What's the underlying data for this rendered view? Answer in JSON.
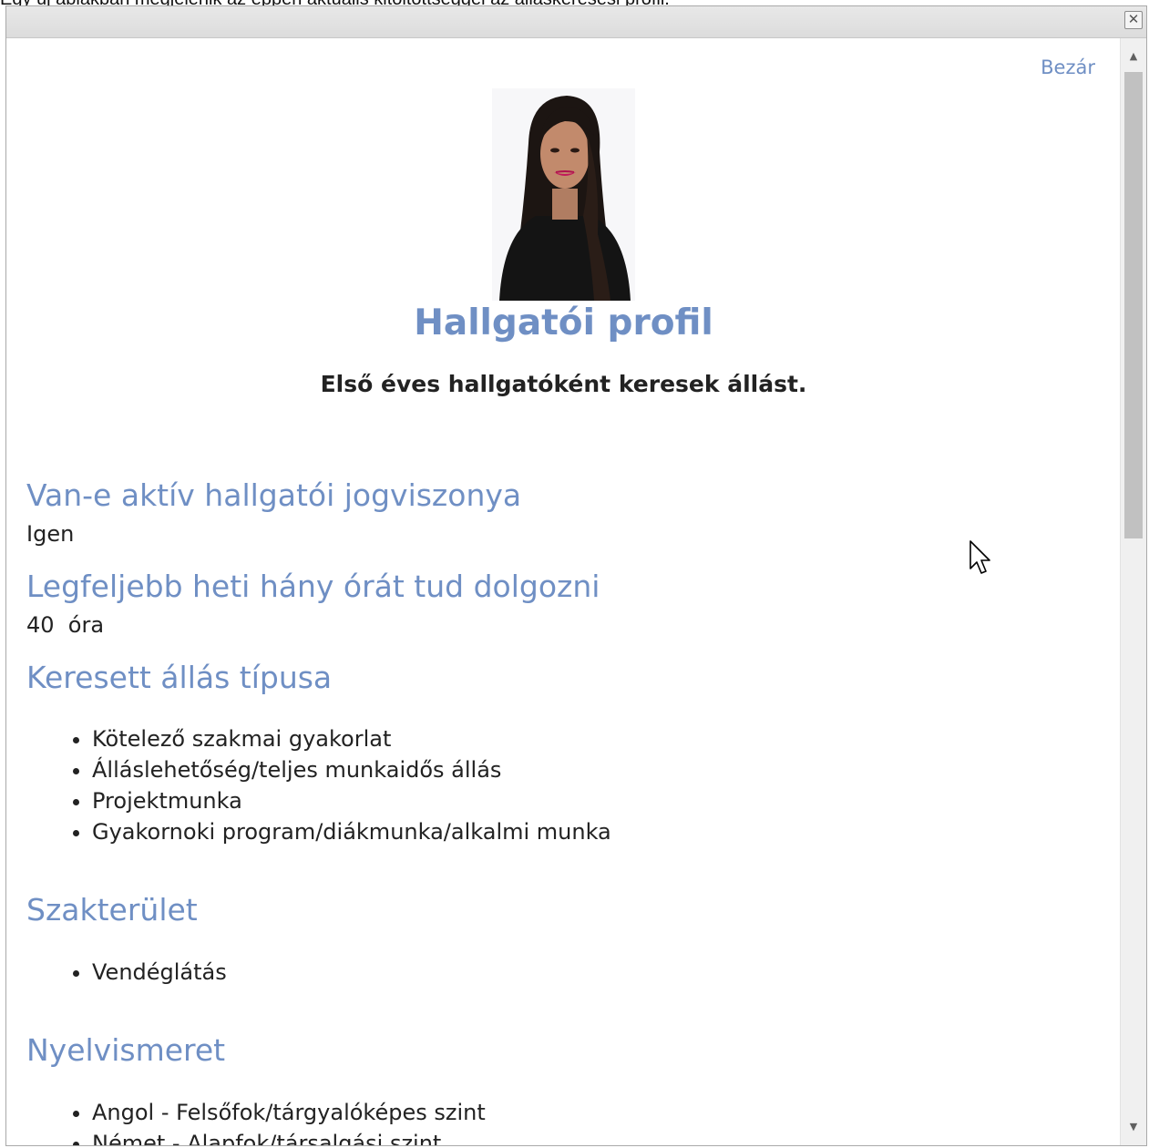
{
  "caption": "Egy új ablakban megjelenik az éppen aktuális kitöltöttséggel az álláskeresési profil.",
  "dialog": {
    "close_glyph": "✕",
    "close_link": "Bezár"
  },
  "profile": {
    "title": "Hallgatói profil",
    "subtitle": "Első éves hallgatóként keresek állást."
  },
  "sections": {
    "active_status": {
      "heading": "Van-e aktív hallgatói jogviszonya",
      "value": "Igen"
    },
    "weekly_hours": {
      "heading": "Legfeljebb heti hány órát tud dolgozni",
      "value": "40  óra"
    },
    "job_type": {
      "heading": "Keresett állás típusa",
      "items": [
        "Kötelező szakmai gyakorlat",
        "Álláslehetőség/teljes munkaidős állás",
        "Projektmunka",
        "Gyakornoki program/diákmunka/alkalmi munka"
      ]
    },
    "field": {
      "heading": "Szakterület",
      "items": [
        "Vendéglátás"
      ]
    },
    "languages": {
      "heading": "Nyelvismeret",
      "items": [
        "Angol - Felsőfok/tárgyalóképes szint",
        "Német - Alapfok/társalgási szint"
      ]
    }
  },
  "scrollbar": {
    "up_glyph": "▲",
    "down_glyph": "▼"
  }
}
